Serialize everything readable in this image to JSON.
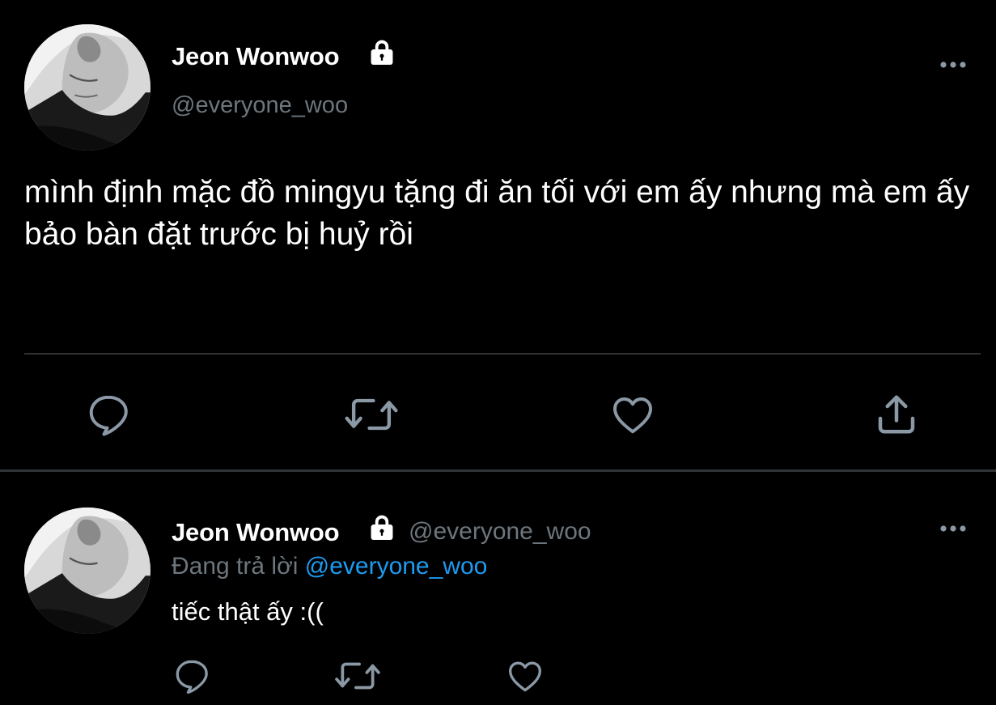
{
  "main_tweet": {
    "display_name": "Jeon Wonwoo",
    "handle": "@everyone_woo",
    "text": "mình định mặc đồ mingyu tặng đi ăn tối với em ấy nhưng mà em ấy bảo bàn đặt trước bị huỷ rồi",
    "icons": {
      "lock": "lock-icon",
      "more": "more-horizontal-icon",
      "reply": "reply-icon",
      "retweet": "retweet-icon",
      "like": "like-icon",
      "share": "share-icon"
    }
  },
  "reply_tweet": {
    "display_name": "Jeon Wonwoo",
    "handle": "@everyone_woo",
    "replying_prefix": "Đang trả lời",
    "replying_to": "@everyone_woo",
    "text": "tiếc thật ấy :(("
  },
  "colors": {
    "background": "#000000",
    "text_primary": "#ffffff",
    "text_secondary": "#6e767d",
    "mention": "#1d9bf0",
    "divider": "#2f3336",
    "icon": "#8b98a5"
  }
}
